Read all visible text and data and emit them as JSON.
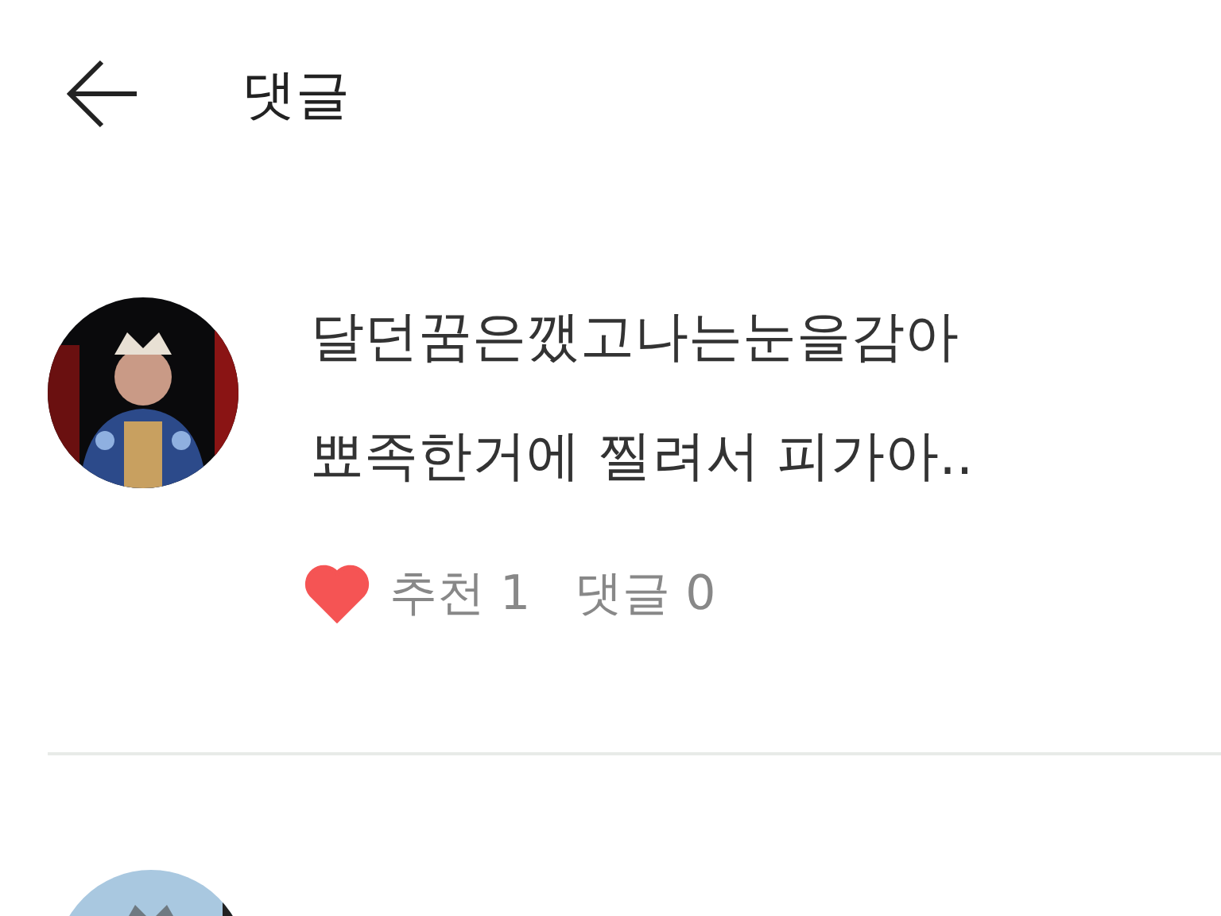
{
  "header": {
    "title": "댓글"
  },
  "comments": [
    {
      "kind": "full",
      "lines": [
        "달던꿈은깼고나는눈을감아",
        "뾰족한거에 찔려서 피가아.."
      ],
      "liked": true,
      "likes_label": "추천",
      "likes": "1",
      "replies_label": "댓글",
      "replies": "0"
    },
    {
      "kind": "partial"
    }
  ]
}
